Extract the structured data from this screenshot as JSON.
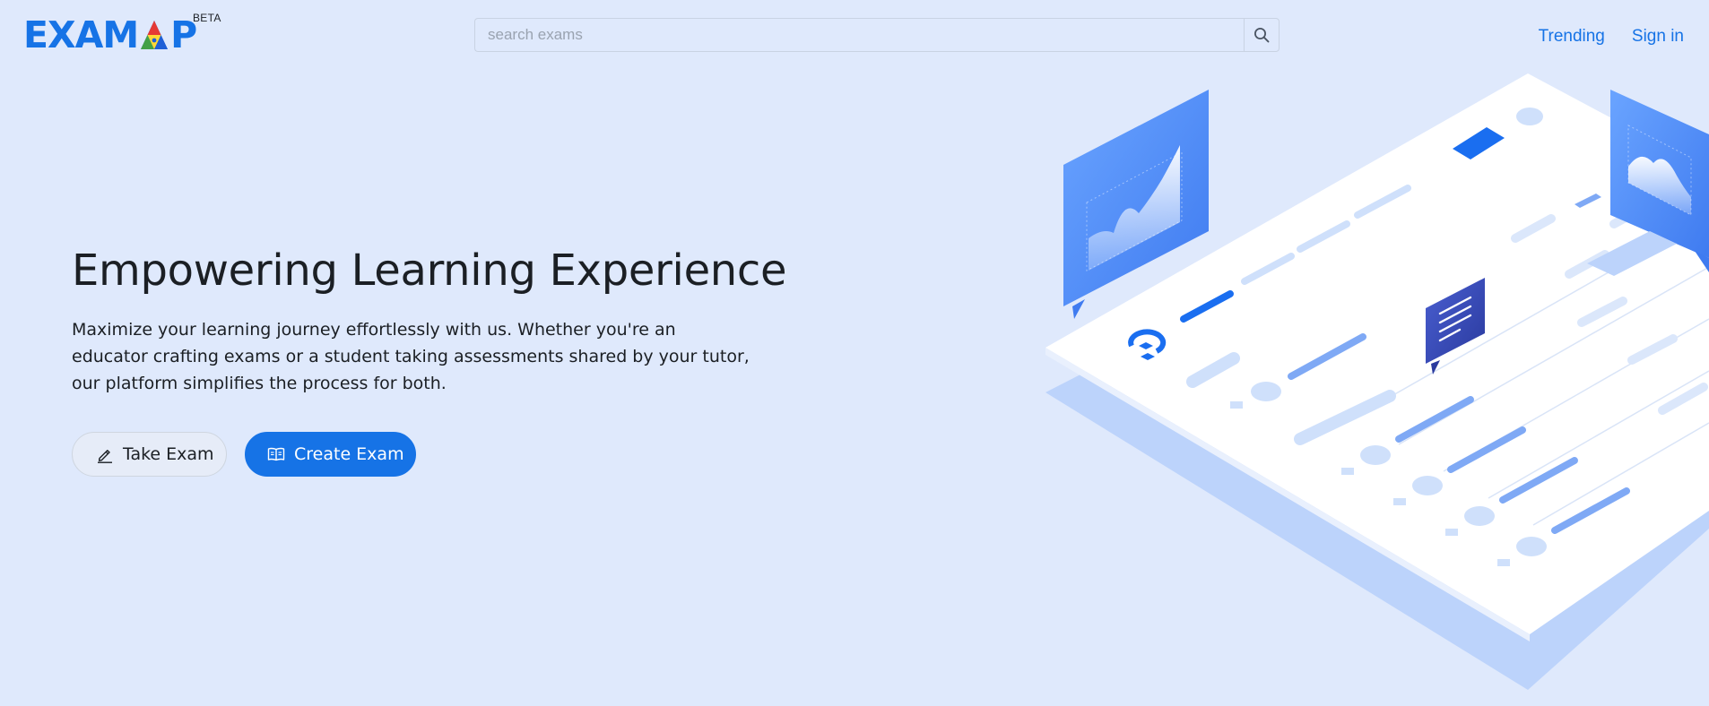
{
  "header": {
    "logo_text_left": "EXAM",
    "logo_text_right": "P",
    "badge": "BETA",
    "search": {
      "placeholder": "search exams",
      "value": "",
      "icon": "search-icon"
    },
    "nav": [
      {
        "label": "Trending"
      },
      {
        "label": "Sign in"
      }
    ]
  },
  "hero": {
    "title": "Empowering Learning Experience",
    "description": "Maximize your learning journey effortlessly with us. Whether you're an educator crafting exams or a student taking assessments shared by your tutor, our platform simplifies the process for both.",
    "buttons": [
      {
        "label": "Take Exam",
        "icon": "pencil-icon"
      },
      {
        "label": "Create Exam",
        "icon": "open-book-icon"
      }
    ]
  },
  "colors": {
    "brand_blue": "#1673e6",
    "background": "#dfe9fc",
    "text": "#1b1f24",
    "logo_triangle": [
      "#e53935",
      "#43a047",
      "#1e5fd6",
      "#fdd835"
    ]
  }
}
